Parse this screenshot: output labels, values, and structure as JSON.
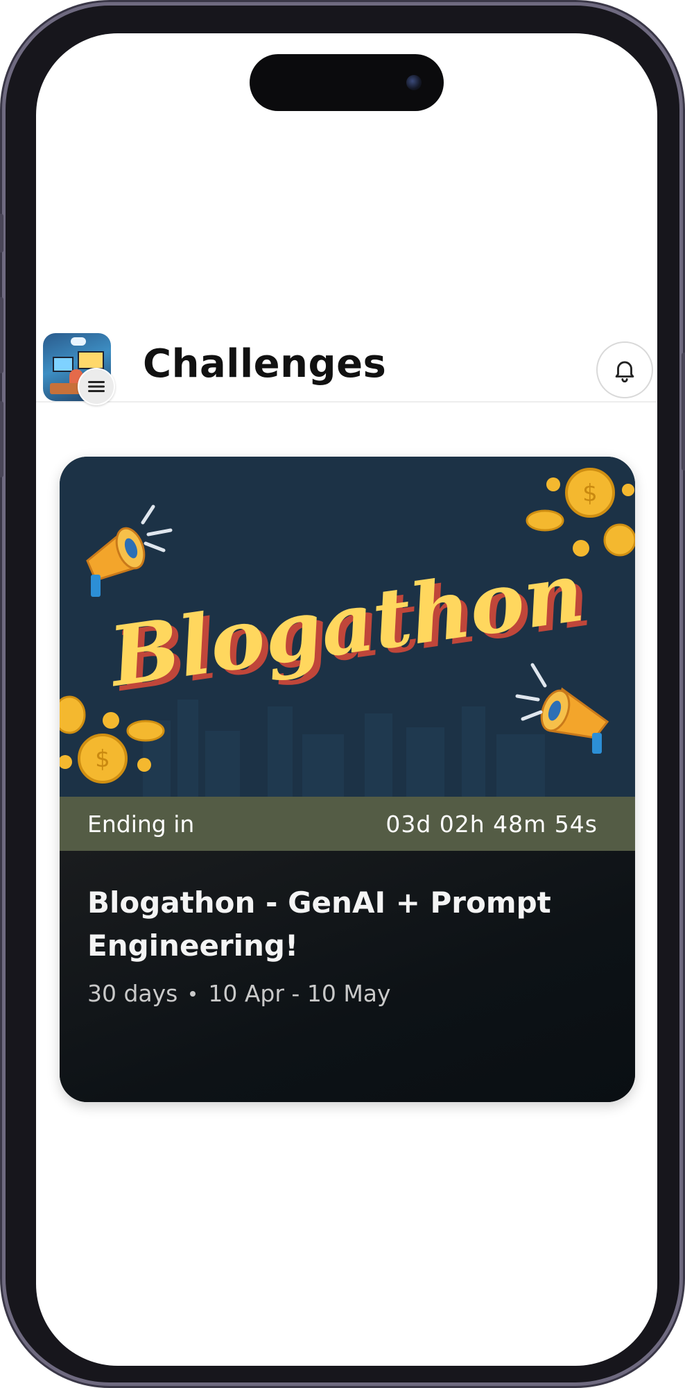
{
  "header": {
    "title": "Challenges"
  },
  "challenge_card": {
    "banner_text": "Blogathon",
    "countdown_label": "Ending in",
    "countdown_value": "03d 02h 48m 54s",
    "title": "Blogathon - GenAI + Prompt Engineering!",
    "duration": "30 days",
    "date_range": "10 Apr - 10 May"
  },
  "icons": {
    "avatar": "profile-avatar",
    "menu": "hamburger-menu-icon",
    "notifications": "bell-icon"
  },
  "colors": {
    "banner_bg": "#1c3246",
    "banner_text": "#ffd75e",
    "countdown_bar": "#545c45",
    "card_body": "#0d1216"
  }
}
